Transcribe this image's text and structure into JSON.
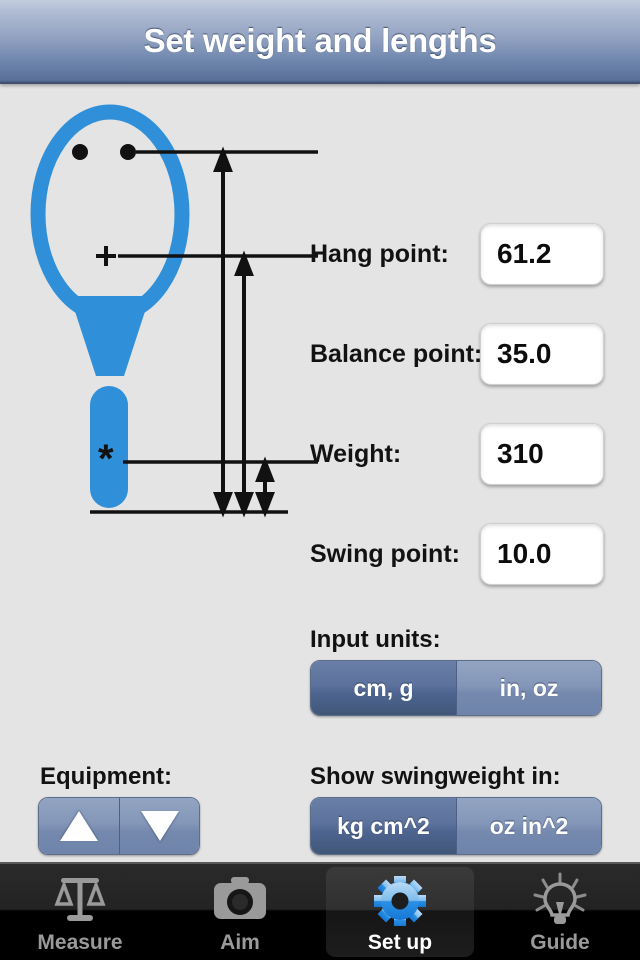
{
  "header": {
    "title": "Set weight and lengths"
  },
  "diagram": {
    "name": "racket-diagram",
    "racket_color": "#2f8fd8",
    "markers": {
      "hang_point": "● ●",
      "balance_point": "+",
      "swing_point": "*"
    }
  },
  "fields": [
    {
      "name": "hang-point",
      "label": "Hang point:",
      "value": "61.2"
    },
    {
      "name": "balance-point",
      "label": "Balance point:",
      "value": "35.0"
    },
    {
      "name": "weight",
      "label": "Weight:",
      "value": "310"
    },
    {
      "name": "swing-point",
      "label": "Swing point:",
      "value": "10.0"
    }
  ],
  "input_units": {
    "label": "Input units:",
    "options": [
      {
        "label": "cm, g",
        "selected": true
      },
      {
        "label": "in, oz",
        "selected": false
      }
    ]
  },
  "swingweight_units": {
    "label": "Show swingweight in:",
    "options": [
      {
        "label": "kg cm^2",
        "selected": true
      },
      {
        "label": "oz in^2",
        "selected": false
      }
    ]
  },
  "equipment": {
    "label": "Equipment:",
    "up_icon": "triangle-up-icon",
    "down_icon": "triangle-down-icon"
  },
  "tabbar": {
    "tabs": [
      {
        "label": "Measure",
        "icon": "scales-icon",
        "active": false
      },
      {
        "label": "Aim",
        "icon": "camera-icon",
        "active": false
      },
      {
        "label": "Set up",
        "icon": "gear-icon",
        "active": true
      },
      {
        "label": "Guide",
        "icon": "lightbulb-icon",
        "active": false
      }
    ]
  },
  "colors": {
    "accent_blue": "#2f8fd8",
    "nav_top": "#c3cddd",
    "nav_bottom": "#4a5f86",
    "background": "#e4e4e4"
  }
}
